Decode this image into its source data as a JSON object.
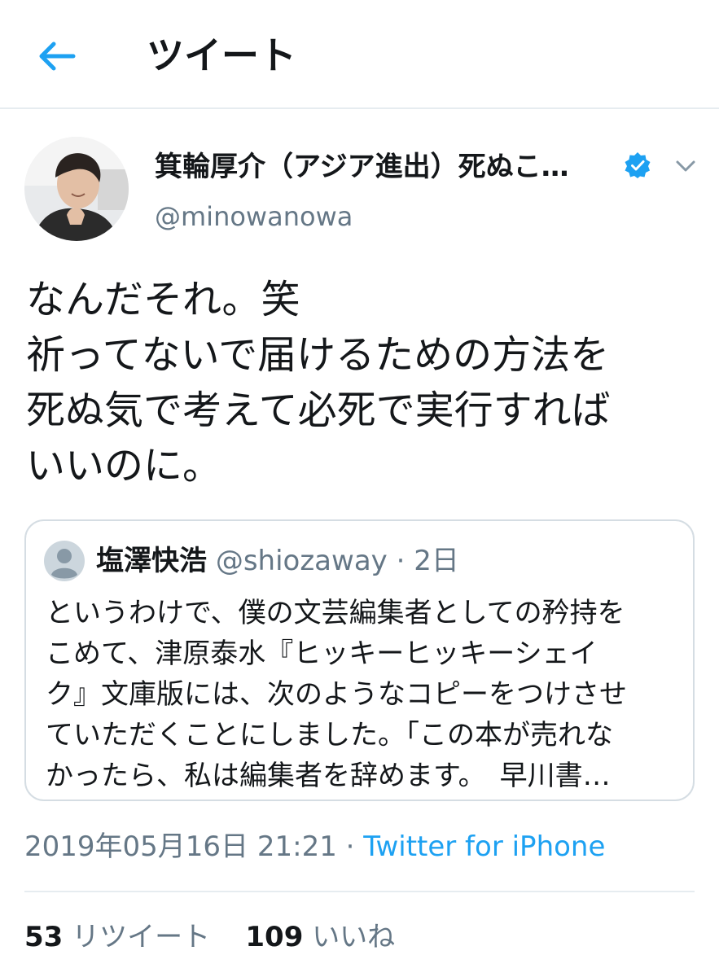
{
  "header": {
    "title": "ツイート",
    "back_icon": "back-arrow-icon"
  },
  "colors": {
    "accent": "#1da1f2",
    "secondary_text": "#657786",
    "primary_text": "#14171a",
    "border": "#e6ecf0"
  },
  "tweet": {
    "author": {
      "display_name": "箕輪厚介（アジア進出）死ぬこ…",
      "handle": "@minowanowa",
      "verified_icon": "verified-badge-icon"
    },
    "text_lines": [
      "なんだそれ。笑",
      "祈ってないで届けるための方法を",
      "死ぬ気で考えて必死で実行すれば",
      "いいのに。"
    ],
    "quoted": {
      "name": "塩澤快浩",
      "handle": "@shiozaway",
      "separator": "·",
      "time": "2日",
      "text_lines": [
        "というわけで、僕の文芸編集者としての矜持を",
        "こめて、津原泰水『ヒッキーヒッキーシェイ",
        "ク』文庫版には、次のようなコピーをつけさせ",
        "ていただくことにしました。「この本が売れな",
        "かったら、私は編集者を辞めます。　早川書…"
      ]
    },
    "timestamp": "2019年05月16日 21:21",
    "meta_separator": "·",
    "source": "Twitter for iPhone",
    "stats": {
      "retweets_count": "53",
      "retweets_label": "リツイート",
      "likes_count": "109",
      "likes_label": "いいね"
    }
  }
}
